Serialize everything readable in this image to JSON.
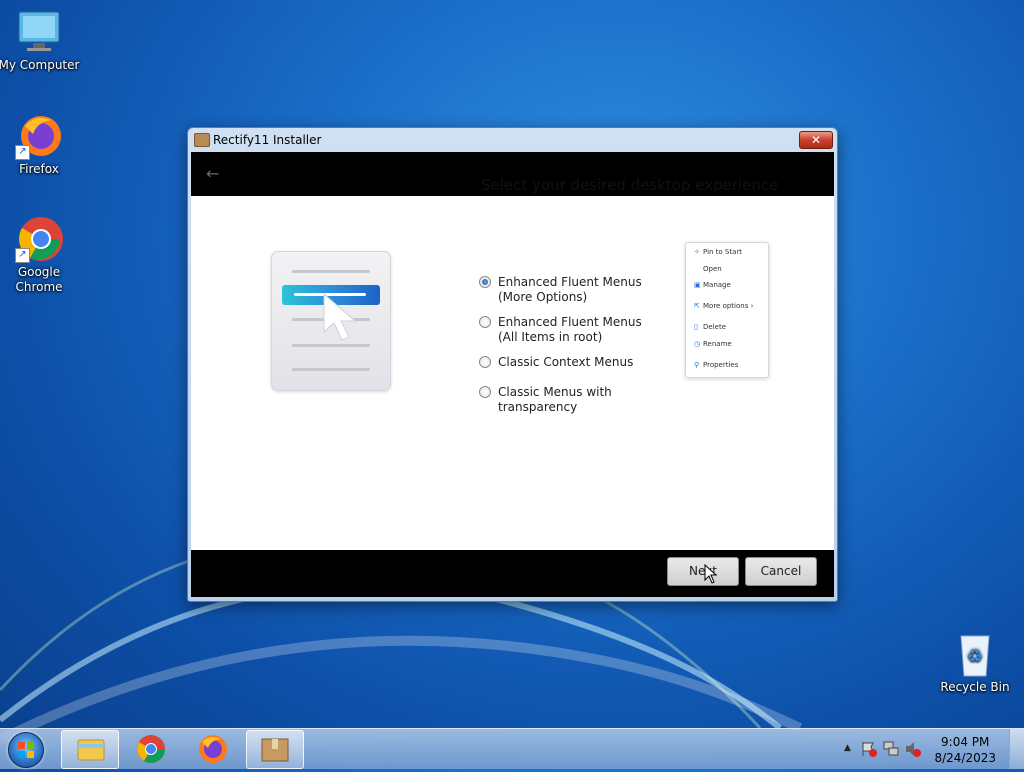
{
  "desktop": {
    "icons": [
      {
        "label": "My Computer"
      },
      {
        "label": "Firefox"
      },
      {
        "label": "Google\nChrome"
      },
      {
        "label": "Recycle Bin"
      }
    ]
  },
  "window": {
    "title": "Rectify11 Installer",
    "close_glyph": "✕",
    "back_glyph": "←",
    "heading": "Select your desired desktop experience",
    "options": [
      {
        "label": "Enhanced Fluent Menus\n(More Options)",
        "checked": true
      },
      {
        "label": "Enhanced Fluent Menus\n(All Items in root)",
        "checked": false
      },
      {
        "label": "Classic Context Menus",
        "checked": false
      },
      {
        "label": "Classic Menus with\ntransparency",
        "checked": false
      }
    ],
    "preview_menu": [
      {
        "icon": "pin-icon",
        "label": "Pin to Start"
      },
      {
        "icon": "",
        "label": "Open"
      },
      {
        "icon": "manage-icon",
        "label": "Manage"
      },
      {
        "icon": "more-options-icon",
        "label": "More options"
      },
      {
        "icon": "trash-icon",
        "label": "Delete"
      },
      {
        "icon": "rename-icon",
        "label": "Rename"
      },
      {
        "icon": "wrench-icon",
        "label": "Properties"
      }
    ],
    "next_label": "Next",
    "cancel_label": "Cancel"
  },
  "taskbar": {
    "time": "9:04 PM",
    "date": "8/24/2023",
    "tray_up_glyph": "▲"
  }
}
